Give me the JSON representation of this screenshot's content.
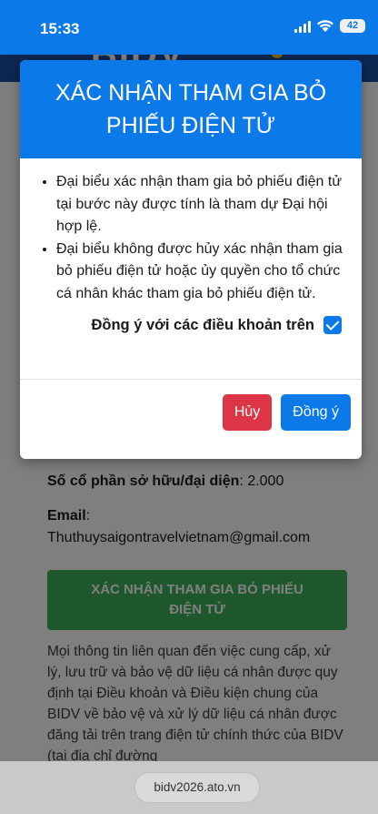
{
  "status_bar": {
    "time": "15:33",
    "battery": "42",
    "icons": [
      "signal-icon",
      "wifi-icon",
      "battery-icon"
    ]
  },
  "background": {
    "logo": "BIDV",
    "shares_label": "Số cổ phần sở hữu/đại diện",
    "shares_value": ": 2.000",
    "email_label": "Email",
    "email_colon": ":",
    "email_value": "Thuthuysaigontravelvietnam@gmail.com",
    "confirm_button": "XÁC NHẬN THAM GIA BỎ PHIẾU ĐIỆN TỬ",
    "notice": "Mọi thông tin liên quan đến việc cung cấp, xử lý, lưu trữ và bảo vệ dữ liệu cá nhân được quy định tại Điều khoản và Điều kiện chung của BIDV về bảo vệ và xử lý dữ liệu cá nhân được đăng tải trên trang điện tử chính thức của BIDV (tại địa chỉ đường"
  },
  "modal": {
    "title": "XÁC NHẬN THAM GIA BỎ PHIẾU ĐIỆN TỬ",
    "bullets": [
      "Đại biểu xác nhận tham gia bỏ phiếu điện tử tại bước này được tính là tham dự Đại hội hợp lệ.",
      "Đại biểu không được hủy xác nhận tham gia bỏ phiếu điện tử hoặc ủy quyền cho tổ chức cá nhân khác tham gia bỏ phiếu điện tử."
    ],
    "agree_label": "Đồng ý với các điều khoản trên",
    "agree_checked": true,
    "cancel_label": "Hủy",
    "ok_label": "Đồng ý"
  },
  "url_bar": {
    "url": "bidv2026.ato.vn"
  },
  "colors": {
    "primary": "#0b79e8",
    "danger": "#dc3545",
    "success": "#3fae5a",
    "bidv_navy": "#1a4fa3"
  }
}
